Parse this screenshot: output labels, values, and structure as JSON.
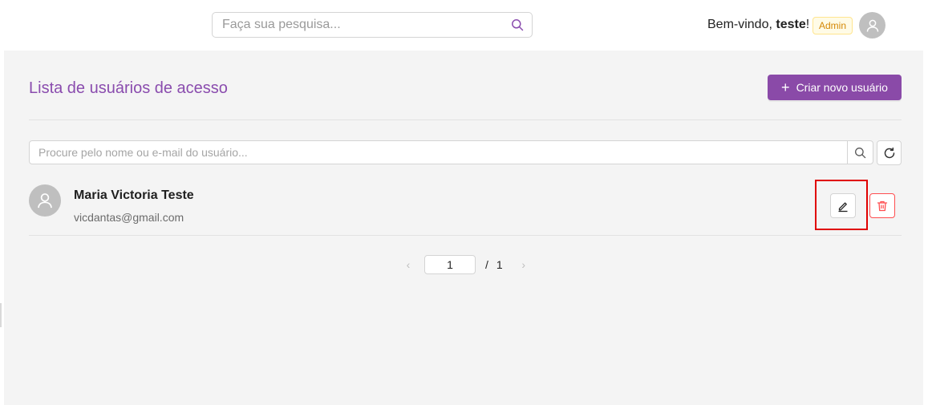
{
  "header": {
    "search_placeholder": "Faça sua pesquisa...",
    "welcome_prefix": "Bem-vindo,",
    "username": "teste",
    "welcome_suffix": "!",
    "role_badge": "Admin"
  },
  "main": {
    "title": "Lista de usuários de acesso",
    "create_button_icon": "+",
    "create_button_label": "Criar novo usuário",
    "user_search_placeholder": "Procure pelo nome ou e-mail do usuário..."
  },
  "users": [
    {
      "name": "Maria Victoria Teste",
      "email": "vicdantas@gmail.com"
    }
  ],
  "pagination": {
    "current_page": "1",
    "separator": "/",
    "total_pages": "1",
    "prev_icon": "‹",
    "next_icon": "›"
  },
  "colors": {
    "accent": "#8a4aa8",
    "title": "#8a4cae",
    "danger": "#ff4d4f",
    "highlight": "#e00000",
    "badge_text": "#d48806"
  }
}
